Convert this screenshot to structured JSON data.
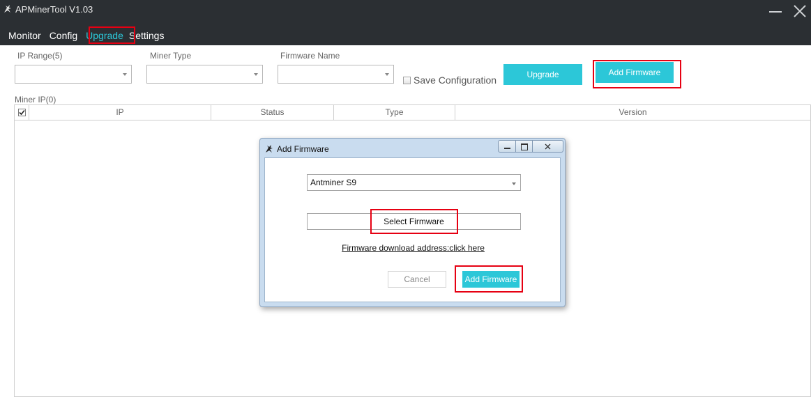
{
  "app": {
    "title": "APMinerTool V1.03",
    "logo_icon": "miner-logo-icon"
  },
  "menu": {
    "items": [
      {
        "label": "Monitor"
      },
      {
        "label": "Config"
      },
      {
        "label": "Upgrade",
        "active": true
      },
      {
        "label": "Settings"
      }
    ]
  },
  "toolbar": {
    "ip_range_label": "IP Range(5)",
    "ip_range_value": "",
    "miner_type_label": "Miner Type",
    "miner_type_value": "",
    "firmware_name_label": "Firmware Name",
    "firmware_name_value": "",
    "save_configuration_label": "Save Configuration",
    "upgrade_label": "Upgrade",
    "add_firmware_label": "Add Firmware"
  },
  "table": {
    "count_label": "Miner IP(0)",
    "columns": [
      "IP",
      "Status",
      "Type",
      "Version"
    ],
    "select_all_checked": true,
    "rows": []
  },
  "dialog": {
    "title": "Add Firmware",
    "miner_model": "Antminer S9",
    "select_firmware_label": "Select Firmware",
    "download_link": "Firmware download address:click here",
    "cancel_label": "Cancel",
    "add_label": "Add Firmware"
  },
  "colors": {
    "titlebar": "#2b2f33",
    "accent": "#2cc7d8",
    "highlight": "#e60012",
    "dialog_frame": "#c9dcef"
  }
}
